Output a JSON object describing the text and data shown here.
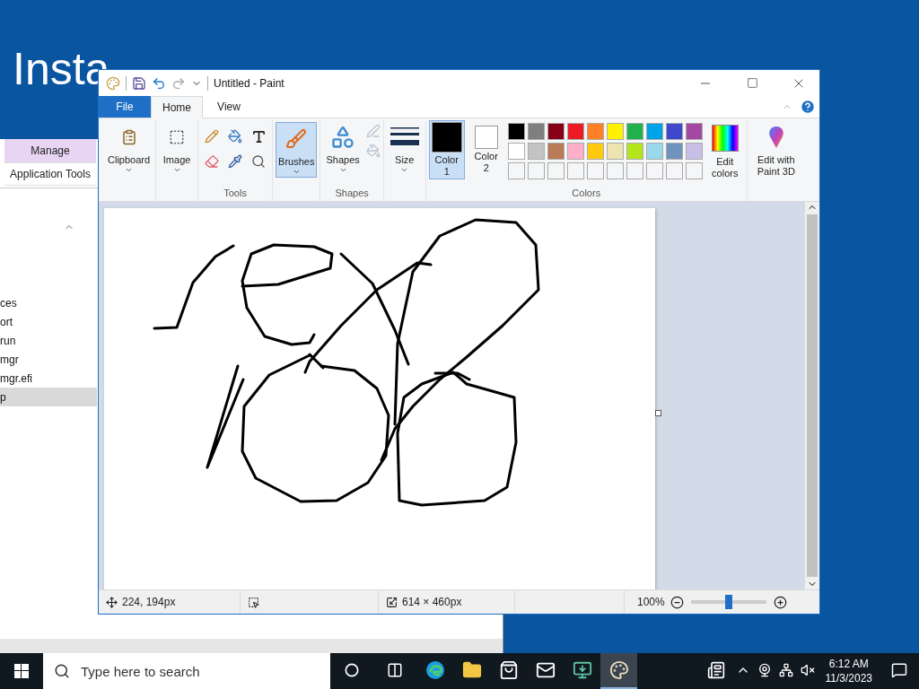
{
  "desktop": {
    "heading": "Insta"
  },
  "explorer": {
    "tabs": [
      {
        "label": "Manage",
        "kind": "context"
      },
      {
        "label": "Application Tools",
        "kind": "plain"
      }
    ],
    "files": [
      {
        "name": "ces",
        "selected": false
      },
      {
        "name": "ort",
        "selected": false
      },
      {
        "name": "run",
        "selected": false
      },
      {
        "name": "mgr",
        "selected": false
      },
      {
        "name": "mgr.efi",
        "selected": false
      },
      {
        "name": "p",
        "selected": true
      }
    ]
  },
  "paint": {
    "title": "Untitled - Paint",
    "tabs": [
      {
        "label": "File",
        "kind": "file",
        "selected": false
      },
      {
        "label": "Home",
        "kind": "tab",
        "selected": true
      },
      {
        "label": "View",
        "kind": "tab",
        "selected": false
      }
    ],
    "ribbon": {
      "clipboard": "Clipboard",
      "image": "Image",
      "tools_label": "Tools",
      "brushes": {
        "label": "Brushes",
        "selected": true
      },
      "shapes": "Shapes",
      "shapes_label": "Shapes",
      "size": "Size",
      "color_slots": [
        {
          "label": "Color",
          "number": "1",
          "color": "#000000",
          "selected": true
        },
        {
          "label": "Color",
          "number": "2",
          "color": "#ffffff",
          "selected": false
        }
      ],
      "palette": [
        {
          "kind": "filled",
          "color": "#000000"
        },
        {
          "kind": "filled",
          "color": "#7f7f7f"
        },
        {
          "kind": "filled",
          "color": "#880015"
        },
        {
          "kind": "filled",
          "color": "#ed1c24"
        },
        {
          "kind": "filled",
          "color": "#ff7f27"
        },
        {
          "kind": "filled",
          "color": "#fff200"
        },
        {
          "kind": "filled",
          "color": "#22b14c"
        },
        {
          "kind": "filled",
          "color": "#00a2e8"
        },
        {
          "kind": "filled",
          "color": "#3f48cc"
        },
        {
          "kind": "filled",
          "color": "#a349a4"
        },
        {
          "kind": "filled",
          "color": "#ffffff"
        },
        {
          "kind": "filled",
          "color": "#c3c3c3"
        },
        {
          "kind": "filled",
          "color": "#b97a57"
        },
        {
          "kind": "filled",
          "color": "#ffaec9"
        },
        {
          "kind": "filled",
          "color": "#ffc90e"
        },
        {
          "kind": "filled",
          "color": "#efe4b0"
        },
        {
          "kind": "filled",
          "color": "#b5e61d"
        },
        {
          "kind": "filled",
          "color": "#99d9ea"
        },
        {
          "kind": "filled",
          "color": "#7092be"
        },
        {
          "kind": "filled",
          "color": "#c8bfe7"
        },
        {
          "kind": "empty"
        },
        {
          "kind": "empty"
        },
        {
          "kind": "empty"
        },
        {
          "kind": "empty"
        },
        {
          "kind": "empty"
        },
        {
          "kind": "empty"
        },
        {
          "kind": "empty"
        },
        {
          "kind": "empty"
        },
        {
          "kind": "empty"
        },
        {
          "kind": "empty"
        }
      ],
      "edit_colors": "Edit colors",
      "colors_label": "Colors",
      "paint3d": "Edit with Paint 3D"
    },
    "status": {
      "position": "224, 194px",
      "size": "614 × 460px",
      "zoom": "100%",
      "zoom_slider": {
        "level": 0.5
      }
    }
  },
  "taskbar": {
    "search": {
      "placeholder": "Type here to search"
    },
    "apps": [
      {
        "kind": "edge",
        "selected": false
      },
      {
        "kind": "folder",
        "selected": false
      },
      {
        "kind": "store",
        "selected": false
      },
      {
        "kind": "mail",
        "selected": false
      },
      {
        "kind": "tool",
        "selected": false
      },
      {
        "kind": "paint",
        "selected": true
      }
    ],
    "time": "6:12 AM",
    "date": "11/3/2023"
  }
}
